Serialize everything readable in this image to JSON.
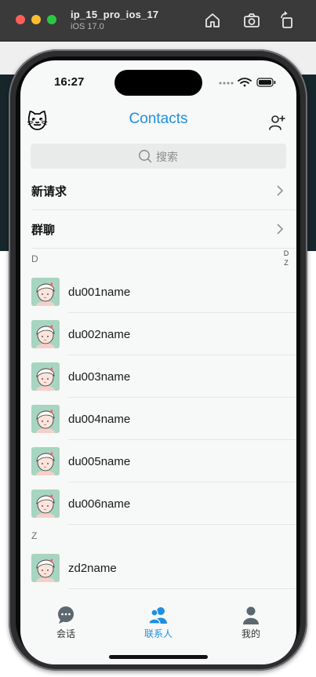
{
  "simulator": {
    "device": "ip_15_pro_ios_17",
    "os": "iOS 17.0"
  },
  "status_bar": {
    "time": "16:27"
  },
  "nav": {
    "title": "Contacts",
    "cat_emoji": "🐱"
  },
  "search": {
    "placeholder": "搜索"
  },
  "menu": [
    {
      "label": "新请求"
    },
    {
      "label": "群聊"
    }
  ],
  "index_letters": [
    "D",
    "Z"
  ],
  "sections": [
    {
      "letter": "D",
      "contacts": [
        "du001name",
        "du002name",
        "du003name",
        "du004name",
        "du005name",
        "du006name"
      ]
    },
    {
      "letter": "Z",
      "contacts": [
        "zd2name"
      ]
    }
  ],
  "tabs": [
    {
      "label": "会话",
      "icon": "chat-bubble-icon",
      "active": false
    },
    {
      "label": "联系人",
      "icon": "contacts-icon",
      "active": true
    },
    {
      "label": "我的",
      "icon": "person-icon",
      "active": false
    }
  ],
  "colors": {
    "accent": "#1e90e0",
    "avatar_bg": "#a7d5c2"
  }
}
